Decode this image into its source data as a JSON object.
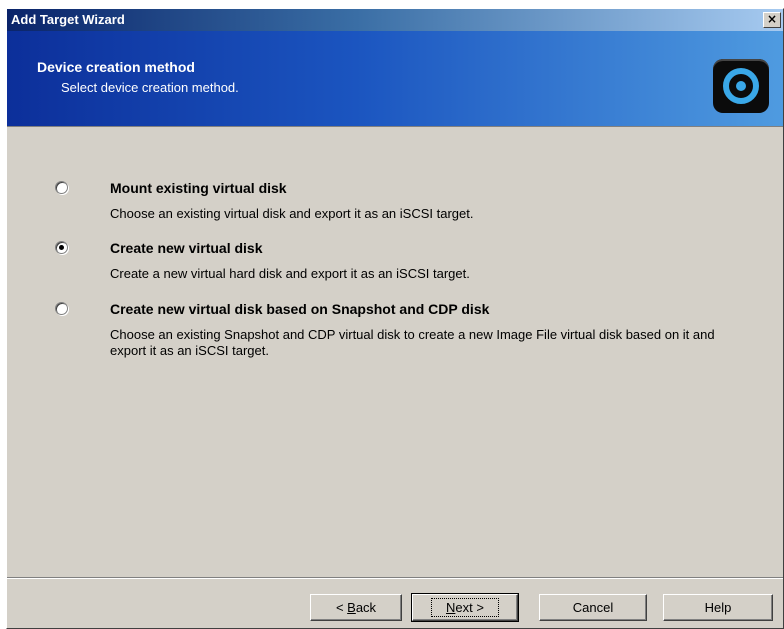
{
  "window": {
    "title": "Add Target Wizard",
    "close_glyph": "×"
  },
  "header": {
    "title": "Device creation method",
    "subtitle": "Select device creation method.",
    "icon": "disk-target-icon"
  },
  "options": [
    {
      "title": "Mount existing virtual disk",
      "description": "Choose an existing virtual disk and export it as an iSCSI target.",
      "selected": false
    },
    {
      "title": "Create new virtual disk",
      "description": "Create a new virtual hard disk and export it as an iSCSI target.",
      "selected": true
    },
    {
      "title": "Create new virtual disk based on Snapshot and CDP disk",
      "description": "Choose an existing Snapshot and CDP virtual disk to create a new Image File virtual disk based on it and export it as an iSCSI target.",
      "selected": false
    }
  ],
  "buttons": {
    "back": {
      "prefix": "< ",
      "mnemonic": "B",
      "rest": "ack"
    },
    "next": {
      "mnemonic": "N",
      "rest": "ext >"
    },
    "cancel": "Cancel",
    "help": "Help"
  }
}
